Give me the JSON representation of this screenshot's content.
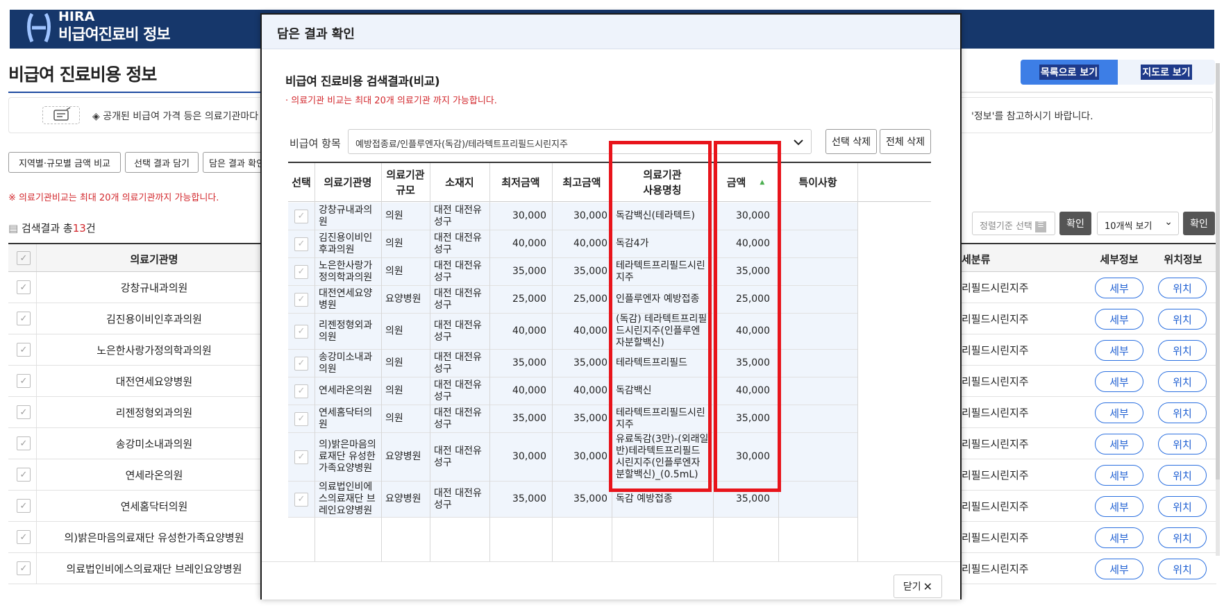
{
  "header": {
    "logo_top": "HIRA",
    "logo_title": "비급여진료비 정보"
  },
  "page_title": "비급여 진료비용 정보",
  "notice": {
    "text": "◈ 공개된 비급여 가격 등은 의료기관마다",
    "text_right": "'정보'를 참고하시기 바랍니다."
  },
  "view_buttons": {
    "list": "목록으로 보기",
    "map": "지도로 보기"
  },
  "action_buttons": [
    "지역별·규모별 금액 비교",
    "선택 결과 담기",
    "담은 결과 확인"
  ],
  "limit_note": "※ 의료기관비교는 최대 20개 의료기관까지 가능합니다.",
  "result": {
    "label_before": "검색결과 총",
    "count": "13",
    "label_after": "건"
  },
  "sort": {
    "placeholder": "정렬기준 선택",
    "confirm": "확인",
    "per_page": "10개씩 보기",
    "confirm2": "확인"
  },
  "bg_table": {
    "headers": {
      "name": "의료기관명",
      "category": "세분류",
      "detail": "세부정보",
      "location": "위치정보"
    },
    "rows": [
      {
        "name": "강창규내과의원",
        "category": "리필드시린지주"
      },
      {
        "name": "김진용이비인후과의원",
        "category": "리필드시린지주"
      },
      {
        "name": "노은한사랑가정의학과의원",
        "category": "리필드시린지주"
      },
      {
        "name": "대전연세요양병원",
        "category": "리필드시린지주"
      },
      {
        "name": "리젠정형외과의원",
        "category": "리필드시린지주"
      },
      {
        "name": "송강미소내과의원",
        "category": "리필드시린지주"
      },
      {
        "name": "연세라온의원",
        "category": "리필드시린지주"
      },
      {
        "name": "연세홈닥터의원",
        "category": "리필드시린지주"
      },
      {
        "name": "의)밝은마음의료재단 유성한가족요양병원",
        "category": "리필드시린지주"
      },
      {
        "name": "의료법인비에스의료재단 브레인요양병원",
        "category": "리필드시린지주"
      }
    ],
    "detail_label": "세부",
    "location_label": "위치"
  },
  "modal": {
    "title": "담은 결과 확인",
    "subtitle": "비급여 진료비용 검색결과(비교)",
    "note": "· 의료기관 비교는 최대 20개 의료기관 까지 가능합니다.",
    "item_label": "비급여 항목",
    "item_value": "예방접종료/인플루엔자(독감)/테라텍트프리필드시린지주",
    "delete_selected": "선택 삭제",
    "delete_all": "전체 삭제",
    "headers": {
      "select": "선택",
      "name": "의료기관명",
      "scale": "의료기관\n규모",
      "location": "소재지",
      "min": "최저금액",
      "max": "최고금액",
      "usage": "의료기관\n사용명칭",
      "amount": "금액",
      "note": "특이사항"
    },
    "rows": [
      {
        "name": "강창규내과의원",
        "scale": "의원",
        "location": "대전 대전유성구",
        "min": "30,000",
        "max": "30,000",
        "usage": "독감백신(테라텍트)",
        "amount": "30,000",
        "note": ""
      },
      {
        "name": "김진용이비인후과의원",
        "scale": "의원",
        "location": "대전 대전유성구",
        "min": "40,000",
        "max": "40,000",
        "usage": "독감4가",
        "amount": "40,000",
        "note": ""
      },
      {
        "name": "노은한사랑가정의학과의원",
        "scale": "의원",
        "location": "대전 대전유성구",
        "min": "35,000",
        "max": "35,000",
        "usage": "테라텍트프리필드시린지주",
        "amount": "35,000",
        "note": ""
      },
      {
        "name": "대전연세요양병원",
        "scale": "요양병원",
        "location": "대전 대전유성구",
        "min": "25,000",
        "max": "25,000",
        "usage": "인플루엔자 예방접종",
        "amount": "25,000",
        "note": ""
      },
      {
        "name": "리젠정형외과의원",
        "scale": "의원",
        "location": "대전 대전유성구",
        "min": "40,000",
        "max": "40,000",
        "usage": "(독감) 테라텍트프리필드시린지주(인플루엔자분할백신)",
        "amount": "40,000",
        "note": ""
      },
      {
        "name": "송강미소내과의원",
        "scale": "의원",
        "location": "대전 대전유성구",
        "min": "35,000",
        "max": "35,000",
        "usage": "테라텍트프리필드",
        "amount": "35,000",
        "note": ""
      },
      {
        "name": "연세라온의원",
        "scale": "의원",
        "location": "대전 대전유성구",
        "min": "40,000",
        "max": "40,000",
        "usage": "독감백신",
        "amount": "40,000",
        "note": ""
      },
      {
        "name": "연세홈닥터의원",
        "scale": "의원",
        "location": "대전 대전유성구",
        "min": "35,000",
        "max": "35,000",
        "usage": "테라텍트프리필드시린지주",
        "amount": "35,000",
        "note": ""
      },
      {
        "name": "의)밝은마음의료재단 유성한가족요양병원",
        "scale": "요양병원",
        "location": "대전 대전유성구",
        "min": "30,000",
        "max": "30,000",
        "usage": "유료독감(3만)-(외래일반)테라텍트프리필드시린지주(인플루엔자분할백신)_(0.5mL)",
        "amount": "30,000",
        "note": ""
      },
      {
        "name": "의료법인비에스의료재단 브레인요양병원",
        "scale": "요양병원",
        "location": "대전 대전유성구",
        "min": "35,000",
        "max": "35,000",
        "usage": "독감 예방접종",
        "amount": "35,000",
        "note": ""
      }
    ],
    "close": "닫기"
  }
}
